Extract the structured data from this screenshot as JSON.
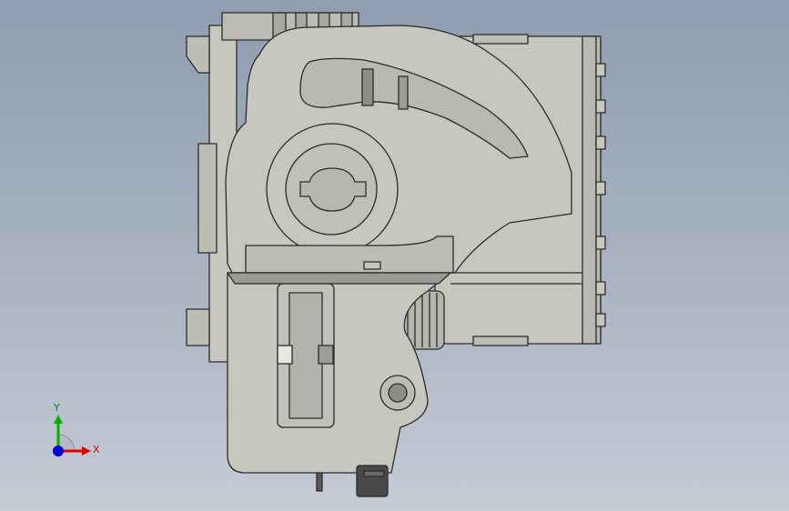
{
  "viewport": {
    "triad": {
      "x_label": "X",
      "y_label": "Y",
      "x_color": "#e00000",
      "y_color": "#00b000",
      "z_color": "#0000d0"
    },
    "model_colors": {
      "body": "#c7c7bf",
      "body_dark": "#a9a9a1",
      "edge": "#2b2b2b",
      "shadow": "#8e8e86",
      "insert": "#bcbcb4",
      "black_part": "#4a4a4a"
    }
  }
}
